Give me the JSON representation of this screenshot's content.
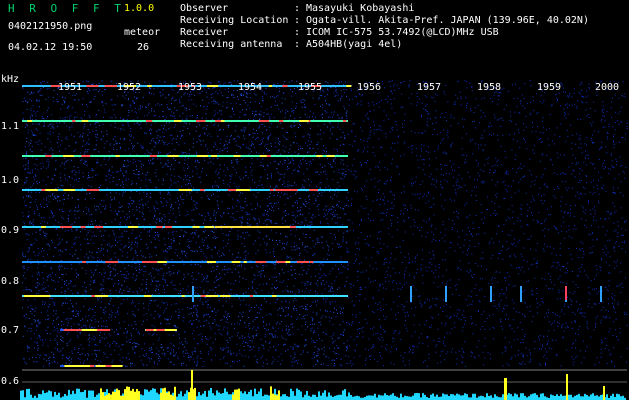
{
  "header": {
    "app_title": "H R O F F T",
    "version": "1.0.0",
    "filename": "0402121950.png",
    "meteor_label": "meteor",
    "datetime": "04.02.12 19:50",
    "meteor_count": "26"
  },
  "info": [
    {
      "label": "Observer",
      "value": "Masayuki Kobayashi"
    },
    {
      "label": "Receiving Location",
      "value": "Ogata-vill. Akita-Pref. JAPAN (139.96E, 40.02N)"
    },
    {
      "label": "Receiver",
      "value": "ICOM IC-575 53.7492(@LCD)MHz USB"
    },
    {
      "label": "Receiving antenna",
      "value": "A504HB(yagi 4el)"
    }
  ],
  "axis": {
    "unit": "kHz",
    "y_ticks": [
      "1.1",
      "1.0",
      "0.9",
      "0.8",
      "0.7",
      "0.6"
    ],
    "time_ticks": [
      "1951",
      "1952",
      "1953",
      "1954",
      "1955",
      "1956",
      "1957",
      "1958",
      "1959",
      "2000"
    ]
  },
  "colors": {
    "background": "#000000",
    "title_green": "#00d26a",
    "version_yellow": "#ffff00",
    "noise_blue": "#1020a0",
    "line_cyan": "#00ffff",
    "meteor_yellow": "#ffff00"
  }
}
